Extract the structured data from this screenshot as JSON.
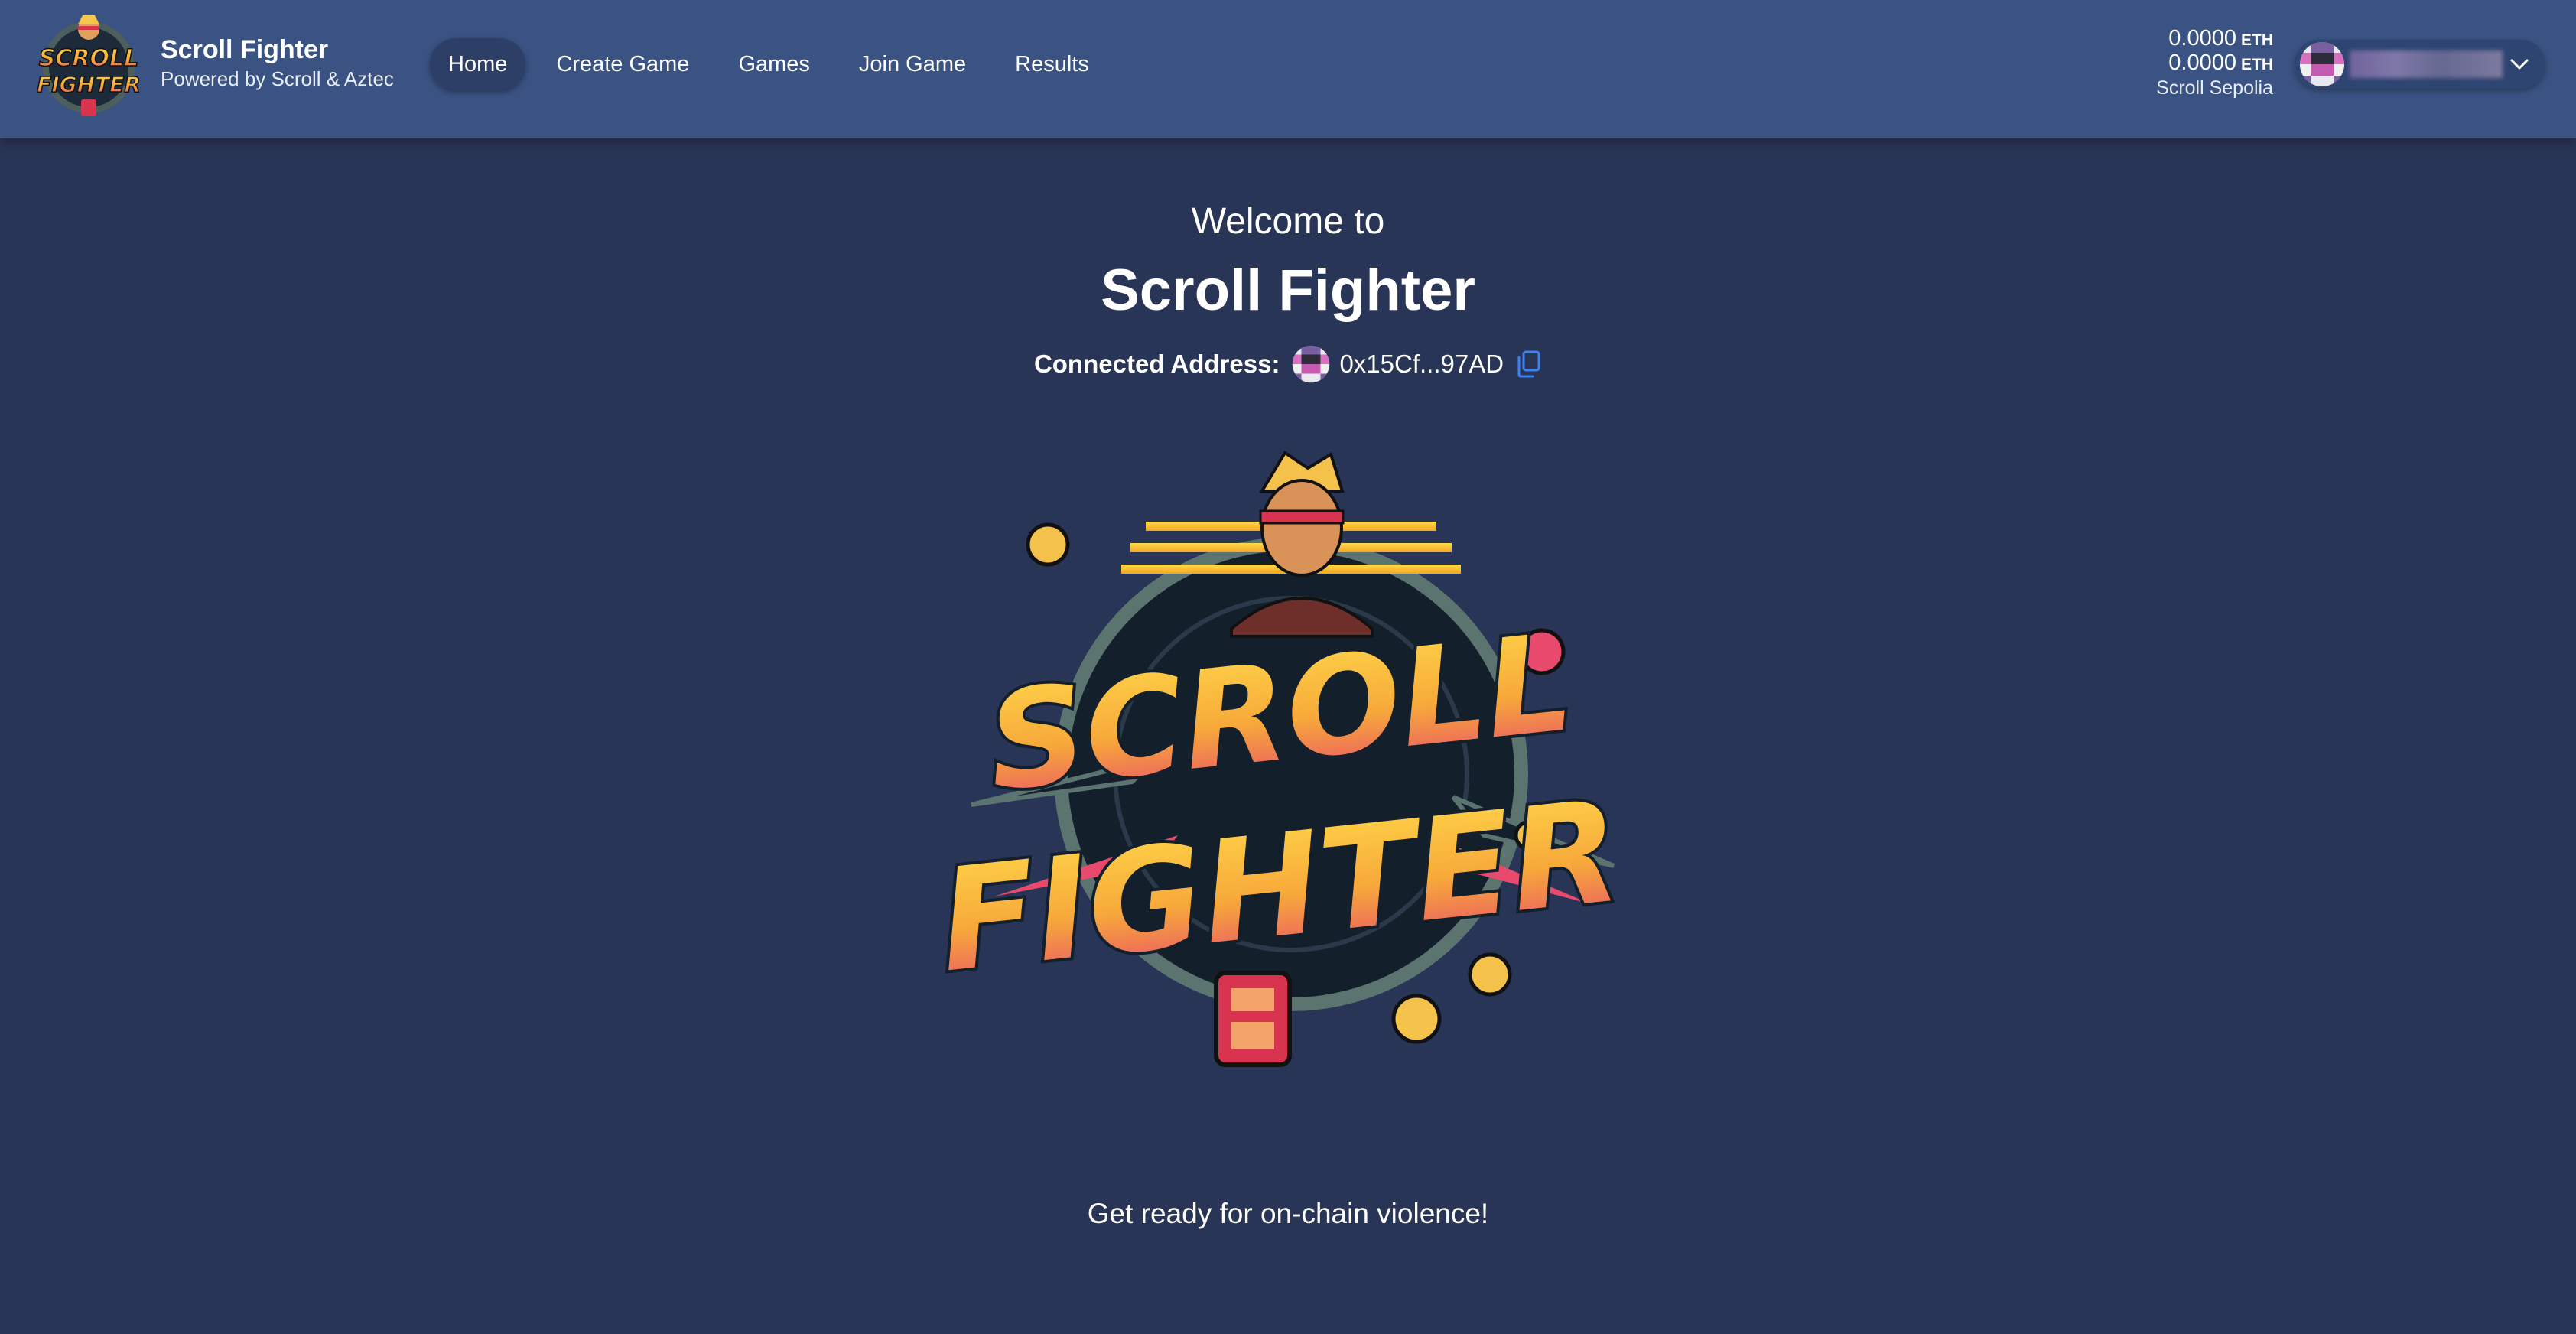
{
  "app": {
    "name": "Scroll Fighter",
    "subtitle": "Powered by Scroll & Aztec",
    "logo_text_top": "SCROLL",
    "logo_text_bottom": "FIGHTER"
  },
  "nav": {
    "items": [
      {
        "label": "Home",
        "active": true
      },
      {
        "label": "Create Game",
        "active": false
      },
      {
        "label": "Games",
        "active": false
      },
      {
        "label": "Join Game",
        "active": false
      },
      {
        "label": "Results",
        "active": false
      }
    ]
  },
  "wallet": {
    "balance_1": "0.0000",
    "balance_1_unit": "ETH",
    "balance_2": "0.0000",
    "balance_2_unit": "ETH",
    "network": "Scroll Sepolia",
    "avatar_icon": "identicon-avatar",
    "dropdown_icon": "chevron-down-icon"
  },
  "main": {
    "welcome": "Welcome to",
    "title": "Scroll Fighter",
    "connected_label": "Connected Address:",
    "address": "0x15Cf...97AD",
    "copy_icon": "copy-icon",
    "hero_text_top": "SCROLL",
    "hero_text_bottom": "FIGHTER",
    "tagline": "Get ready for on-chain violence!"
  },
  "colors": {
    "header_bg": "#3a5383",
    "page_bg": "#293556",
    "active_nav_bg": "#2d3f66",
    "copy_icon": "#3b82f6",
    "logo_yellow": "#f9c733",
    "logo_pink": "#e84a6d",
    "logo_dark": "#121e2e"
  }
}
